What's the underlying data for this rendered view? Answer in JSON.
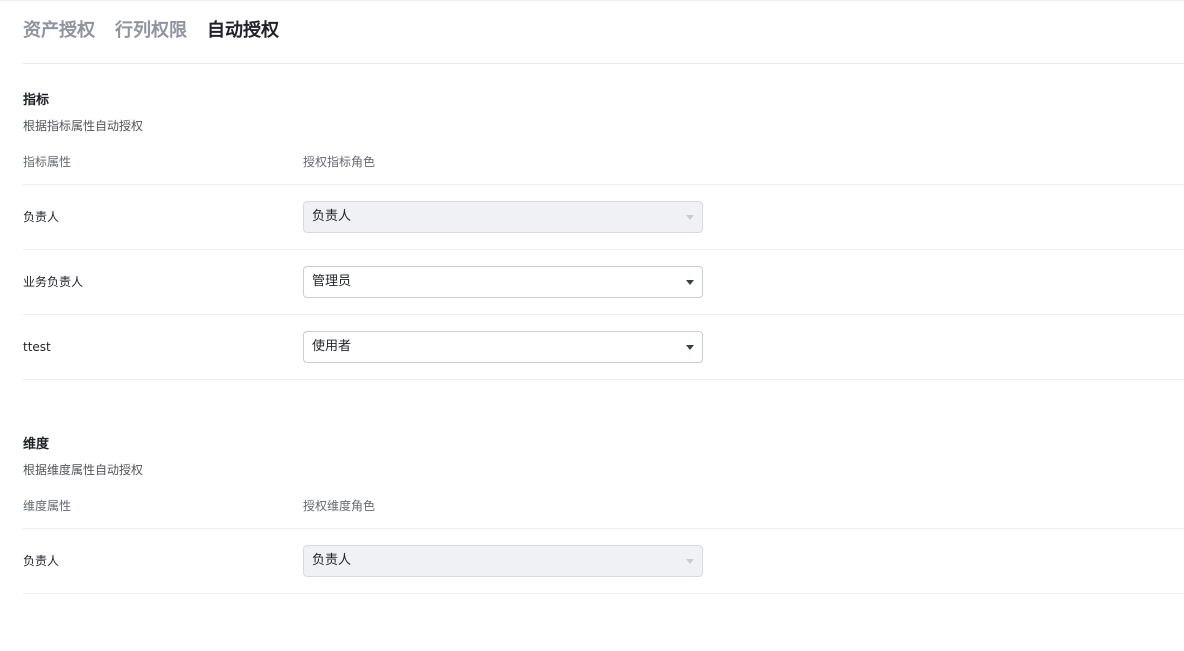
{
  "tabs": [
    {
      "label": "资产授权",
      "active": false
    },
    {
      "label": "行列权限",
      "active": false
    },
    {
      "label": "自动授权",
      "active": true
    }
  ],
  "metric_section": {
    "title": "指标",
    "description": "根据指标属性自动授权",
    "header": {
      "attribute": "指标属性",
      "role": "授权指标角色"
    },
    "rows": [
      {
        "label": "负责人",
        "value": "负责人",
        "disabled": true
      },
      {
        "label": "业务负责人",
        "value": "管理员",
        "disabled": false
      },
      {
        "label": "ttest",
        "value": "使用者",
        "disabled": false
      }
    ]
  },
  "dimension_section": {
    "title": "维度",
    "description": "根据维度属性自动授权",
    "header": {
      "attribute": "维度属性",
      "role": "授权维度角色"
    },
    "rows": [
      {
        "label": "负责人",
        "value": "负责人",
        "disabled": true
      }
    ]
  },
  "colors": {
    "active_tab": "#1f2329",
    "inactive_tab": "#8f959e",
    "disabled_select_bg": "#eff1f4"
  },
  "icons": {
    "select_caret": "caret-down-icon"
  }
}
